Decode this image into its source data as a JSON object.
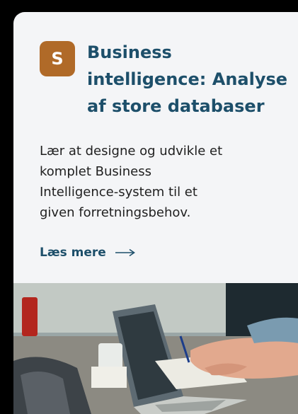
{
  "card": {
    "badge_letter": "S",
    "title": "Business intelligence: Analyse af store databaser",
    "description": "Lær at designe og udvikle et komplet Business Intelligence-system til et given forretningsbehov.",
    "read_more": "Læs mere"
  },
  "icons": {
    "read_more_icon": "arrow-right-icon"
  },
  "colors": {
    "badge": "#b06a28",
    "title": "#1d4f6a",
    "link": "#1d4f6a",
    "card_bg": "#f4f5f7"
  }
}
